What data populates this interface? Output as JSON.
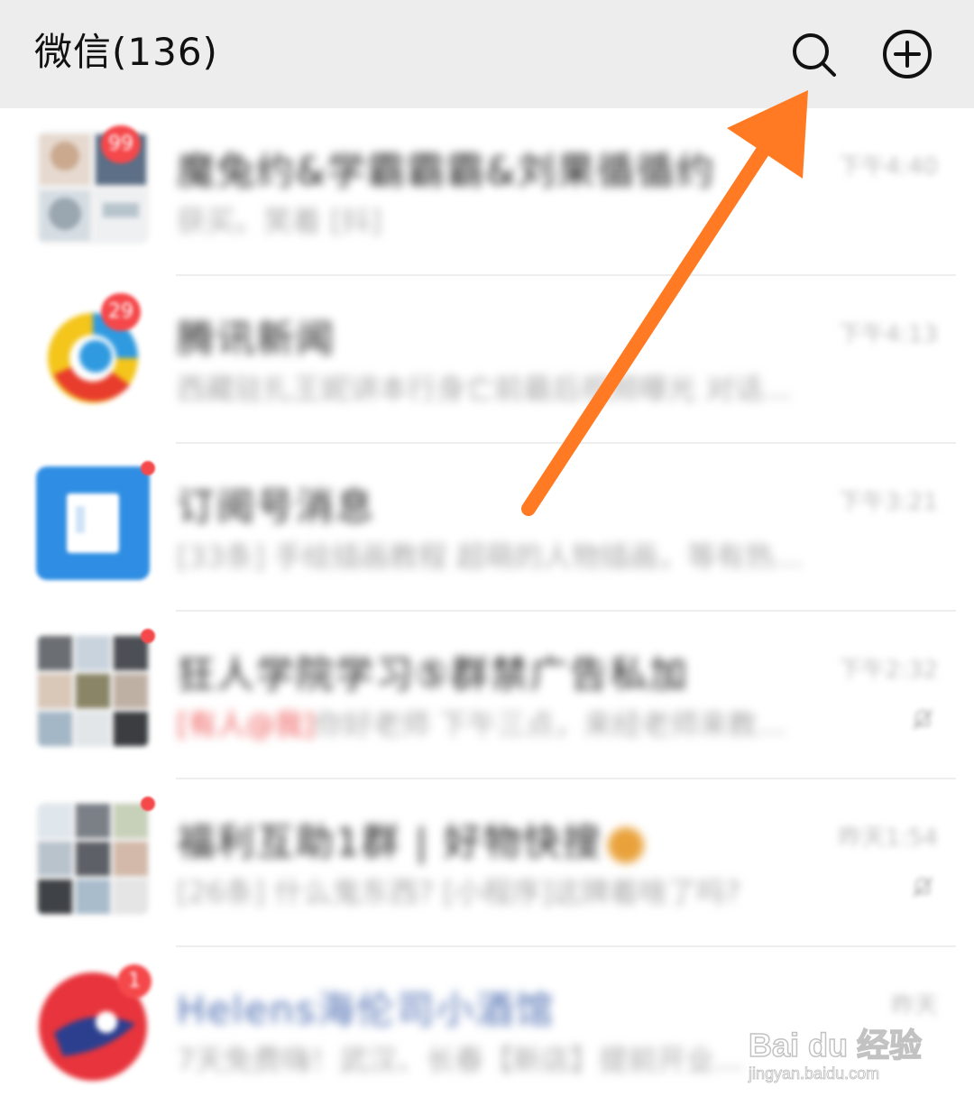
{
  "header": {
    "title": "微信(136)",
    "search_icon": "search-icon",
    "add_icon": "plus-circle-icon"
  },
  "chats": [
    {
      "name": "魔兔约&学霸霸霸&刘果循循约",
      "preview": "获买。笑着 [抖]",
      "time": "下午4:40",
      "badge": "99",
      "muted": false
    },
    {
      "name": "腾讯新闻",
      "preview": "西藏驻扎王妮讲本行身亡前最后视频曝光 对话…",
      "time": "下午4:13",
      "badge": "29",
      "muted": false
    },
    {
      "name": "订阅号消息",
      "preview": "[33条] 手绘插画教程 超萌的人物插画，等有热…",
      "time": "下午3:21",
      "badge": "",
      "muted": false
    },
    {
      "name": "狂人学院学习⑤群禁广告私加",
      "preview_mention": "[有人@我]",
      "preview": "你好老师 下午三点，来经老师来教…",
      "time": "下午2:32",
      "badge": "",
      "muted": true
    },
    {
      "name": "福利互助1群 | 好物快搜",
      "preview": "[26条] 什么鬼东西? [小程序]这牌着啥了吗?",
      "time": "昨天1:54",
      "badge": "",
      "muted": true
    },
    {
      "name": "Helens海伦司小酒馆",
      "preview": "7天免费嗨！武汉、长春【新店】提前开业…",
      "time": "昨天",
      "badge": "1",
      "muted": false
    }
  ],
  "annotation": {
    "color": "#ff7a22"
  },
  "watermark": {
    "brand": "Bai du 经验",
    "url": "jingyan.baidu.com"
  }
}
